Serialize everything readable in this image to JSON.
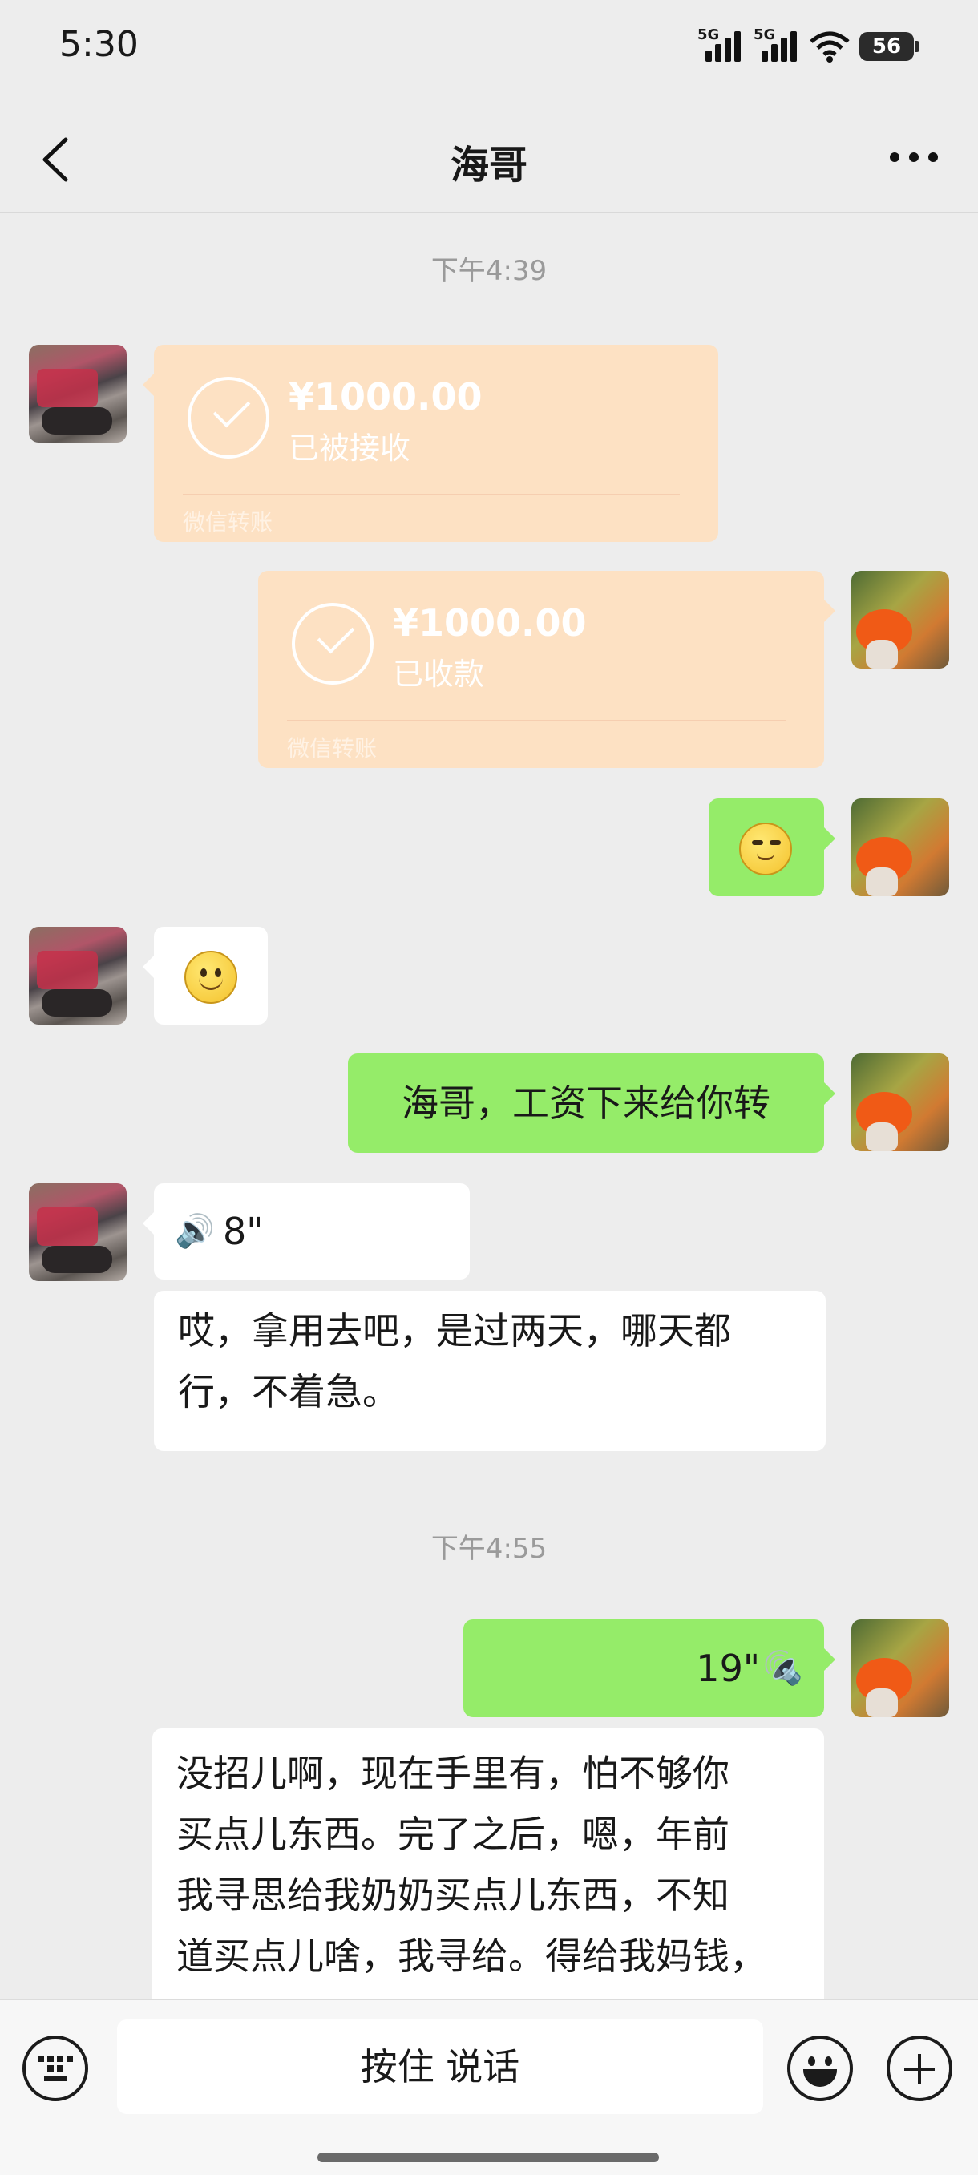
{
  "status_bar": {
    "time": "5:30",
    "network_1": "5G",
    "network_2": "5G",
    "battery": "56"
  },
  "header": {
    "title": "海哥"
  },
  "messages": {
    "time_1": "下午4:39",
    "transfer_received": {
      "amount": "¥1000.00",
      "status": "已被接收",
      "footer": "微信转账"
    },
    "transfer_collected": {
      "amount": "¥1000.00",
      "status": "已收款",
      "footer": "微信转账"
    },
    "text_1": "海哥，工资下来给你转",
    "voice_1": "8\"",
    "text_2_line1": "哎，拿用去吧，是过两天，哪天都",
    "text_2_line2": "行，不着急。",
    "time_2": "下午4:55",
    "voice_2": "19\"",
    "text_3_line1": "没招儿啊，现在手里有，怕不够你",
    "text_3_line2": "买点儿东西。完了之后，嗯，年前",
    "text_3_line3": "我寻思给我奶奶买点儿东西，不知",
    "text_3_line4": "道买点儿啥，我寻给。得给我妈钱，"
  },
  "input_bar": {
    "hold_to_talk": "按住 说话"
  },
  "colors": {
    "green_bubble": "#95ec69",
    "transfer_bg": "#fde1c3",
    "background": "#ededed"
  }
}
